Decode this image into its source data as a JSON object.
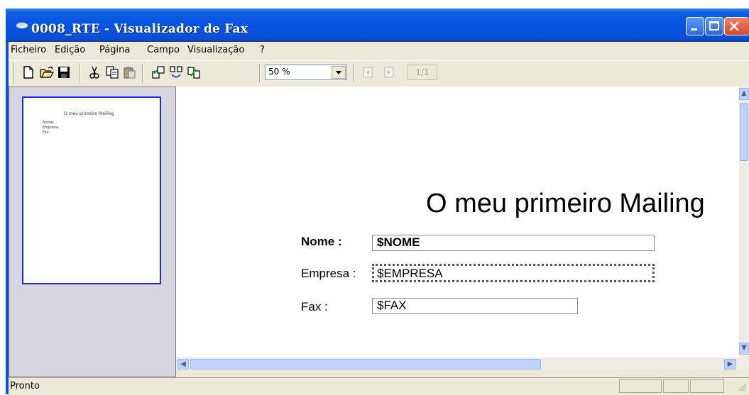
{
  "window": {
    "title": "0008_RTE - Visualizador de Fax"
  },
  "menu": [
    "Ficheiro",
    "Edição",
    "Página",
    "Campo",
    "Visualização",
    "?"
  ],
  "toolbar": {
    "icons": [
      "new-icon",
      "open-icon",
      "save-icon",
      "cut-icon",
      "copy-icon",
      "paste-icon",
      "field-insert-icon",
      "field-refresh-icon",
      "field-link-icon",
      "prev-page-icon",
      "next-page-icon"
    ],
    "zoom_value": "50 %",
    "page_indicator": "1/1"
  },
  "thumbnail": {
    "title": "O meu primeiro Mailing",
    "lines": [
      "Nome:",
      "Empresa:",
      "Fax:"
    ]
  },
  "document": {
    "title": "O meu primeiro Mailing",
    "fields": [
      {
        "label": "Nome :",
        "value": "$NOME"
      },
      {
        "label": "Empresa :",
        "value": "$EMPRESA"
      },
      {
        "label": "Fax :",
        "value": "$FAX"
      }
    ]
  },
  "status": {
    "text": "Pronto"
  },
  "colors": {
    "title_bar": "#0553e2",
    "thumb_border": "#1b2ee6",
    "chrome": "#ece9d8"
  }
}
